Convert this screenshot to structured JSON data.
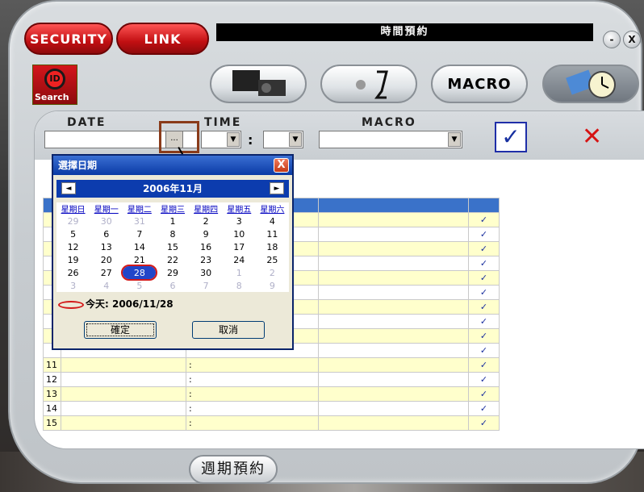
{
  "window": {
    "title": "時間預約",
    "minimize_label": "-",
    "close_label": "X"
  },
  "tabs": {
    "security": "SECURITY",
    "link": "LINK"
  },
  "id_search": {
    "badge": "ID",
    "label": "Search"
  },
  "modes": {
    "macro": "MACRO"
  },
  "form": {
    "date_label": "DATE",
    "time_label": "TIME",
    "time_sep": ":",
    "macro_label": "MACRO",
    "browse_label": "...",
    "confirm_glyph": "✓",
    "cancel_glyph": "✕"
  },
  "calendar_dialog": {
    "title": "選擇日期",
    "close_glyph": "X",
    "month": "2006年11月",
    "prev_glyph": "◄",
    "next_glyph": "►",
    "weekdays": [
      "星期日",
      "星期一",
      "星期二",
      "星期三",
      "星期四",
      "星期五",
      "星期六"
    ],
    "weeks": [
      [
        {
          "d": "29",
          "o": true
        },
        {
          "d": "30",
          "o": true
        },
        {
          "d": "31",
          "o": true
        },
        {
          "d": "1"
        },
        {
          "d": "2"
        },
        {
          "d": "3"
        },
        {
          "d": "4"
        }
      ],
      [
        {
          "d": "5"
        },
        {
          "d": "6"
        },
        {
          "d": "7"
        },
        {
          "d": "8"
        },
        {
          "d": "9"
        },
        {
          "d": "10"
        },
        {
          "d": "11"
        }
      ],
      [
        {
          "d": "12"
        },
        {
          "d": "13"
        },
        {
          "d": "14"
        },
        {
          "d": "15"
        },
        {
          "d": "16"
        },
        {
          "d": "17"
        },
        {
          "d": "18"
        }
      ],
      [
        {
          "d": "19"
        },
        {
          "d": "20"
        },
        {
          "d": "21"
        },
        {
          "d": "22"
        },
        {
          "d": "23"
        },
        {
          "d": "24"
        },
        {
          "d": "25"
        }
      ],
      [
        {
          "d": "26"
        },
        {
          "d": "27"
        },
        {
          "d": "28",
          "sel": true
        },
        {
          "d": "29"
        },
        {
          "d": "30"
        },
        {
          "d": "1",
          "o": true
        },
        {
          "d": "2",
          "o": true
        }
      ],
      [
        {
          "d": "3",
          "o": true
        },
        {
          "d": "4",
          "o": true
        },
        {
          "d": "5",
          "o": true
        },
        {
          "d": "6",
          "o": true
        },
        {
          "d": "7",
          "o": true
        },
        {
          "d": "8",
          "o": true
        },
        {
          "d": "9",
          "o": true
        }
      ]
    ],
    "today_text": "今天: 2006/11/28",
    "ok_label": "確定",
    "cancel_label": "取消"
  },
  "schedule_rows": [
    {
      "n": "",
      "t": ""
    },
    {
      "n": "",
      "t": ""
    },
    {
      "n": "",
      "t": ""
    },
    {
      "n": "",
      "t": ""
    },
    {
      "n": "",
      "t": ""
    },
    {
      "n": "",
      "t": ""
    },
    {
      "n": "",
      "t": ""
    },
    {
      "n": "",
      "t": ""
    },
    {
      "n": "",
      "t": ""
    },
    {
      "n": "",
      "t": ""
    },
    {
      "n": "",
      "t": ""
    },
    {
      "n": "11",
      "t": ":"
    },
    {
      "n": "12",
      "t": ":"
    },
    {
      "n": "13",
      "t": ":"
    },
    {
      "n": "14",
      "t": ":"
    },
    {
      "n": "15",
      "t": ":"
    }
  ],
  "check_glyph": "✓",
  "weekly_button": "週期預約"
}
